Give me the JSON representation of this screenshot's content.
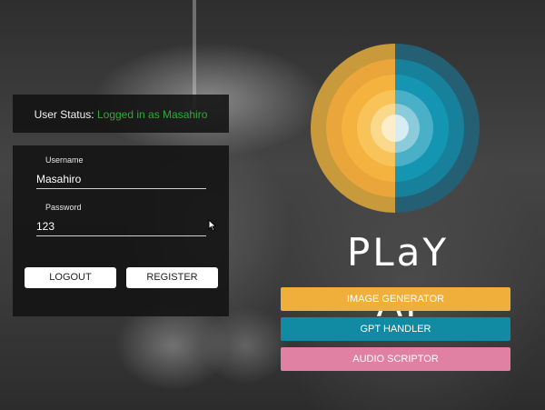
{
  "status": {
    "label": "User Status:",
    "value": "Logged in as Masahiro"
  },
  "form": {
    "username_label": "Username",
    "username_value": "Masahiro",
    "password_label": "Password",
    "password_value": "123",
    "logout_label": "LOGOUT",
    "register_label": "REGISTER"
  },
  "brand": {
    "title": "PLaY AI"
  },
  "nav": {
    "image_generator": "IMAGE GENERATOR",
    "gpt_handler": "GPT HANDLER",
    "audio_scriptor": "AUDIO SCRIPTOR"
  },
  "colors": {
    "status_ok": "#2faa3a",
    "orange": "#f0ae3b",
    "teal": "#118aa4",
    "pink": "#e080a2"
  }
}
